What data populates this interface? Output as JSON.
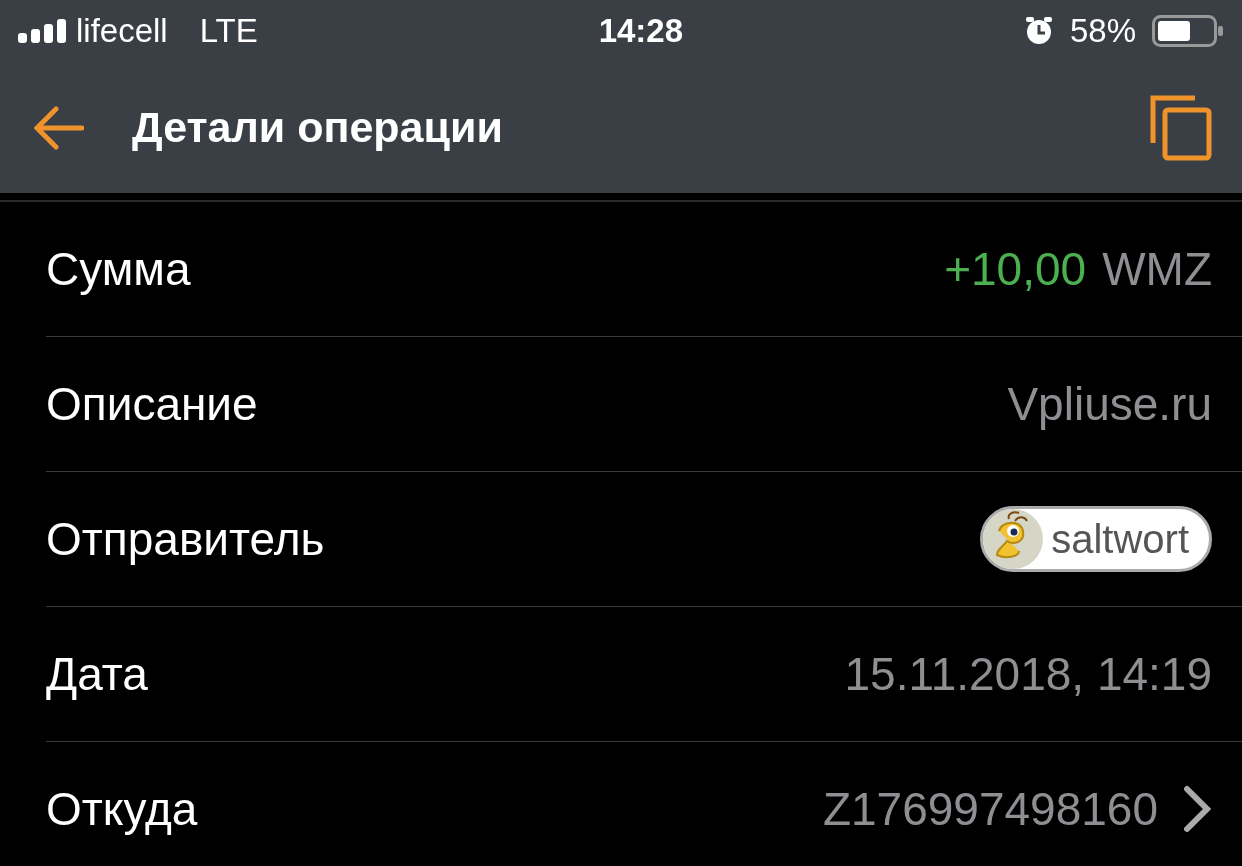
{
  "status_bar": {
    "carrier": "lifecell",
    "network": "LTE",
    "time": "14:28",
    "battery": "58%",
    "alarm": true
  },
  "nav": {
    "title": "Детали операции"
  },
  "rows": [
    {
      "kind": "amount",
      "label": "Сумма",
      "value": "+10,00",
      "currency": "WMZ"
    },
    {
      "kind": "text",
      "label": "Описание",
      "value": "Vpliuse.ru"
    },
    {
      "kind": "user",
      "label": "Отправитель",
      "value": "saltwort"
    },
    {
      "kind": "text",
      "label": "Дата",
      "value": "15.11.2018, 14:19"
    },
    {
      "kind": "link",
      "label": "Откуда",
      "value": "Z176997498160"
    }
  ]
}
